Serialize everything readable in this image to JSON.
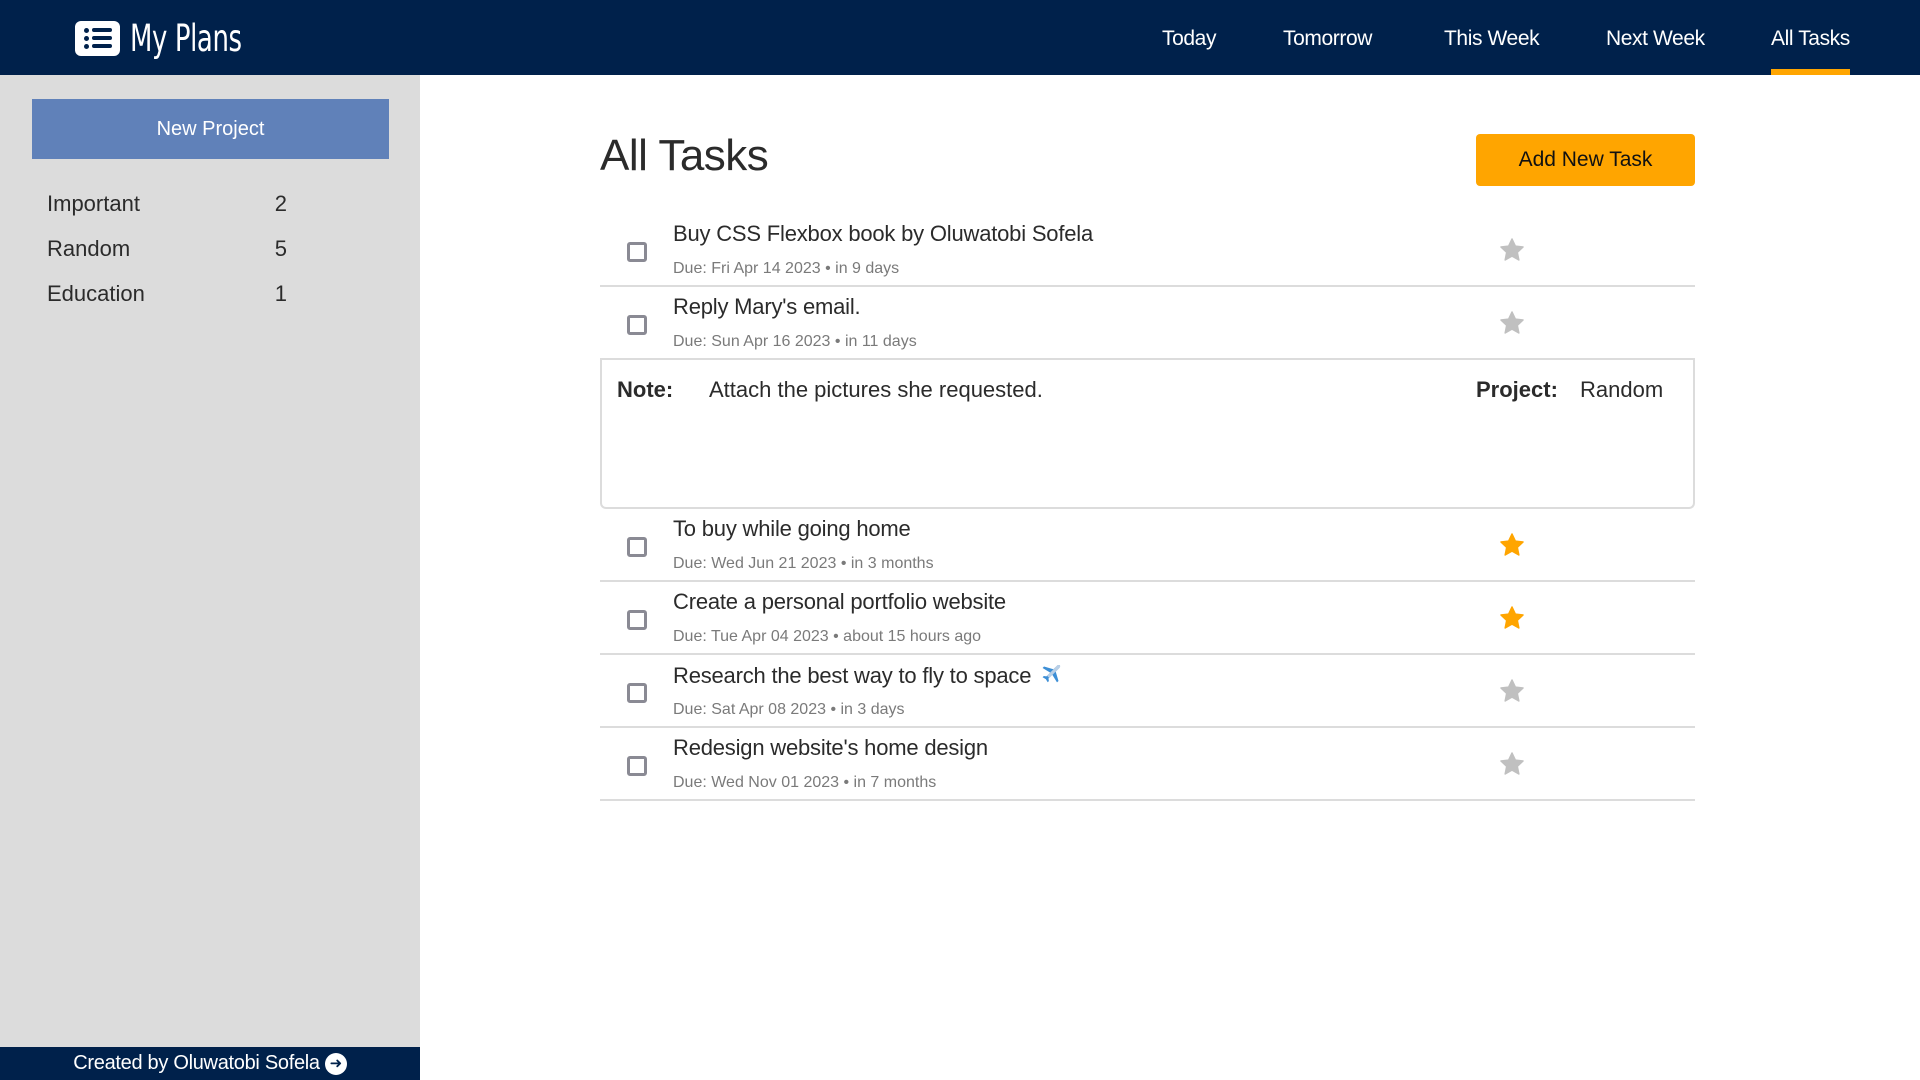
{
  "header": {
    "app_title": "My Plans",
    "brand_icon": "list-icon",
    "nav": [
      {
        "label": "Today",
        "active": false
      },
      {
        "label": "Tomorrow",
        "active": false
      },
      {
        "label": "This Week",
        "active": false
      },
      {
        "label": "Next Week",
        "active": false
      },
      {
        "label": "All Tasks",
        "active": true
      }
    ]
  },
  "sidebar": {
    "new_project_label": "New Project",
    "projects": [
      {
        "name": "Important",
        "count": "2"
      },
      {
        "name": "Random",
        "count": "5"
      },
      {
        "name": "Education",
        "count": "1"
      }
    ],
    "footer_text": "Created by Oluwatobi Sofela",
    "footer_icon": "arrow-circle-right-icon"
  },
  "main": {
    "title": "All Tasks",
    "add_task_label": "Add New Task",
    "tasks": [
      {
        "title": "Buy CSS Flexbox book by Oluwatobi Sofela",
        "due": "Due: Fri Apr 14 2023 • in 9 days",
        "starred": false,
        "done": false
      },
      {
        "title": "Reply Mary's email.",
        "due": "Due: Sun Apr 16 2023 • in 11 days",
        "starred": false,
        "done": false,
        "expanded": true
      },
      {
        "title": "To buy while going home",
        "due": "Due: Wed Jun 21 2023 • in 3 months",
        "starred": true,
        "done": false
      },
      {
        "title": "Create a personal portfolio website",
        "due": "Due: Tue Apr 04 2023 • about 15 hours ago",
        "starred": true,
        "done": false
      },
      {
        "title": "Research the best way to fly to space",
        "title_emoji": "airplane-icon",
        "due": "Due: Sat Apr 08 2023 • in 3 days",
        "starred": false,
        "done": false
      },
      {
        "title": "Redesign website's home design",
        "due": "Due: Wed Nov 01 2023 • in 7 months",
        "starred": false,
        "done": false
      }
    ],
    "note": {
      "label": "Note:",
      "text": "Attach the pictures she requested.",
      "project_label": "Project:",
      "project_value": "Random"
    }
  },
  "colors": {
    "header_bg": "#00214b",
    "accent": "#ffa500",
    "new_project_bg": "#6081b9",
    "sidebar_bg": "#dcdcdc",
    "star_on": "#ffa500",
    "star_off": "#c0c0c0"
  }
}
